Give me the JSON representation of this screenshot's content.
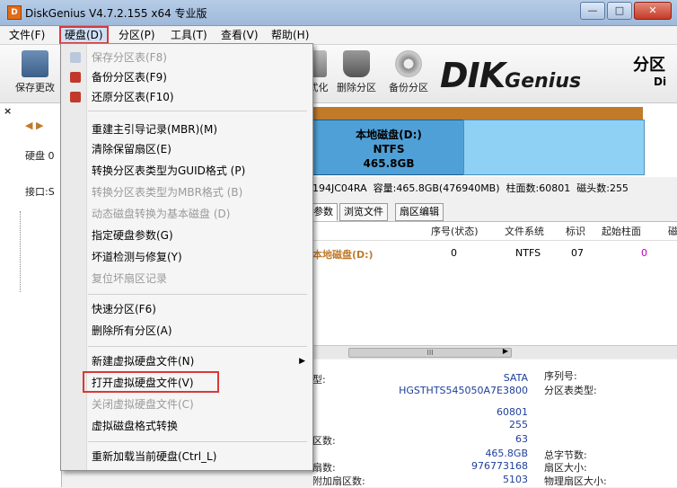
{
  "window": {
    "title": "DiskGenius V4.7.2.155 x64 专业版",
    "app_icon_letter": "D",
    "controls": {
      "minimize": "—",
      "maximize": "□",
      "close": "✕"
    }
  },
  "menubar": {
    "items": [
      "文件(F)",
      "硬盘(D)",
      "分区(P)",
      "工具(T)",
      "查看(V)",
      "帮助(H)"
    ],
    "active_index": 1
  },
  "toolbar": {
    "buttons": [
      {
        "label": "保存更改",
        "icon": "save-icon"
      },
      {
        "label": "格式化",
        "icon": "format-icon"
      },
      {
        "label": "删除分区",
        "icon": "delete-partition-icon"
      },
      {
        "label": "备份分区",
        "icon": "backup-partition-icon"
      }
    ],
    "logo_d": "DI",
    "logo_k": "K",
    "logo_genius": "Genius",
    "right_heading": "分区",
    "right_sub": "Di"
  },
  "left_panel": {
    "close": "×",
    "nav_arrows": "◀ ▶",
    "disk_label": "硬盘 0",
    "interface_label": "接口:S"
  },
  "disk_map": {
    "partition_name": "本地磁盘(D:)",
    "partition_fs": "NTFS",
    "partition_size": "465.8GB"
  },
  "info_line": {
    "model": "194JC04RA",
    "capacity": "容量:465.8GB(476940MB)",
    "cylinders": "柱面数:60801",
    "heads": "磁头数:255"
  },
  "tabs": [
    "参数",
    "浏览文件",
    "扇区编辑"
  ],
  "partition_table": {
    "headers": [
      "序号(状态)",
      "文件系统",
      "标识",
      "起始柱面",
      "磁"
    ],
    "rows": [
      {
        "name": "本地磁盘(D:)",
        "index": "0",
        "fs": "NTFS",
        "id": "07",
        "start_cyl": "0"
      }
    ]
  },
  "scroll_thumb": "III",
  "details": {
    "type_label": "型:",
    "type_value": "SATA",
    "serial_label": "序列号:",
    "model_value": "HGSTHTS545050A7E3800",
    "part_type_label": "分区表类型:",
    "cyl_value": "60801",
    "heads_value": "255",
    "sectors_label": "区数:",
    "sectors_value": "63",
    "capacity_value": "465.8GB",
    "total_bytes_label": "总字节数:",
    "total_sectors_label": "扇数:",
    "total_sectors_value": "976773168",
    "sector_size_label": "扇区大小:",
    "extra_label": "附加扇区数:",
    "extra_value": "5103",
    "phys_sector_label": "物理扇区大小:"
  },
  "dropdown": {
    "items": [
      {
        "label": "保存分区表(F8)",
        "disabled": true,
        "icon": "save-table-icon"
      },
      {
        "label": "备份分区表(F9)",
        "disabled": false,
        "icon": "backup-table-icon"
      },
      {
        "label": "还原分区表(F10)",
        "disabled": false,
        "icon": "restore-table-icon"
      },
      {
        "sep": true
      },
      {
        "label": "重建主引导记录(MBR)(M)",
        "disabled": false
      },
      {
        "label": "清除保留扇区(E)",
        "disabled": false
      },
      {
        "label": "转换分区表类型为GUID格式 (P)",
        "disabled": false
      },
      {
        "label": "转换分区表类型为MBR格式 (B)",
        "disabled": true
      },
      {
        "label": "动态磁盘转换为基本磁盘 (D)",
        "disabled": true
      },
      {
        "label": "指定硬盘参数(G)",
        "disabled": false
      },
      {
        "label": "坏道检测与修复(Y)",
        "disabled": false
      },
      {
        "label": "复位坏扇区记录",
        "disabled": true
      },
      {
        "sep": true
      },
      {
        "label": "快速分区(F6)",
        "disabled": false
      },
      {
        "label": "删除所有分区(A)",
        "disabled": false
      },
      {
        "sep": true
      },
      {
        "label": "新建虚拟硬盘文件(N)",
        "disabled": false,
        "submenu": true
      },
      {
        "label": "打开虚拟硬盘文件(V)",
        "disabled": false,
        "highlight": true
      },
      {
        "label": "关闭虚拟硬盘文件(C)",
        "disabled": true
      },
      {
        "label": "虚拟磁盘格式转换",
        "disabled": false
      },
      {
        "sep": true
      },
      {
        "label": "重新加载当前硬盘(Ctrl_L)",
        "disabled": false
      }
    ],
    "submenu_arrow": "▶"
  }
}
